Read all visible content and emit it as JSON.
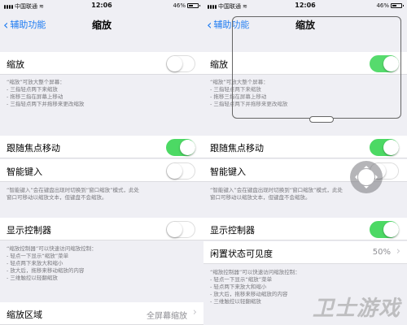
{
  "status_bar": {
    "carrier": "中国联通",
    "time": "12:06",
    "battery": "46%",
    "battery_level": 0.46
  },
  "nav": {
    "back_label": "辅助功能",
    "title": "缩放"
  },
  "left": {
    "zoom": {
      "label": "缩放",
      "on": false
    },
    "zoom_note": [
      "“缩放”可放大整个屏幕：",
      "- 三指轻点两下来缩放",
      "- 拖移三指在屏幕上移动",
      "- 三指轻点两下并拖移来更改缩放"
    ],
    "follow_focus": {
      "label": "跟随焦点移动",
      "on": true
    },
    "smart_typing": {
      "label": "智能键入",
      "on": false
    },
    "smart_note": [
      "“智能键入”会在键盘出现时切换到“窗口缩放”模式，此处",
      "窗口可移动以缩放文本，但键盘不会缩放。"
    ],
    "show_controller": {
      "label": "显示控制器",
      "on": false
    },
    "controller_note": [
      "“缩放控制器”可以快速访问缩放控制：",
      "- 轻点一下显示“缩放”菜单",
      "- 轻点两下来放大和缩小",
      "- 放大后，拖移来移动缩放的内容",
      "- 三维触控以轻翻缩放"
    ],
    "zoom_region": {
      "label": "缩放区域",
      "value": "全屏幕缩放"
    }
  },
  "right": {
    "zoom": {
      "label": "缩放",
      "on": true
    },
    "zoom_note": [
      "“缩放”可放大整个屏幕：",
      "- 三指轻点两下来缩放",
      "- 拖移三指在屏幕上移动",
      "- 三指轻点两下并拖移来更改缩放"
    ],
    "follow_focus": {
      "label": "跟随焦点移动",
      "on": true
    },
    "smart_typing": {
      "label": "智能键入",
      "on": false
    },
    "smart_note": [
      "“智能键入”会在键盘出现时切换到“窗口缩放”模式，此处",
      "窗口可移动以缩放文本，但键盘不会缩放。"
    ],
    "show_controller": {
      "label": "显示控制器",
      "on": true
    },
    "idle_visibility": {
      "label": "闲置状态可见度",
      "value": "50%"
    },
    "controller_note": [
      "“缩放控制器”可以快速访问缩放控制：",
      "- 轻点一下显示“缩放”菜单",
      "- 轻点两下来放大和缩小",
      "- 放大后，拖移来移动缩放的内容",
      "- 三维触控以轻翻缩放"
    ]
  },
  "watermark": "卫士游戏",
  "colors": {
    "accent": "#1d7bf2",
    "toggle_on": "#4cd964",
    "background": "#efeff4"
  }
}
